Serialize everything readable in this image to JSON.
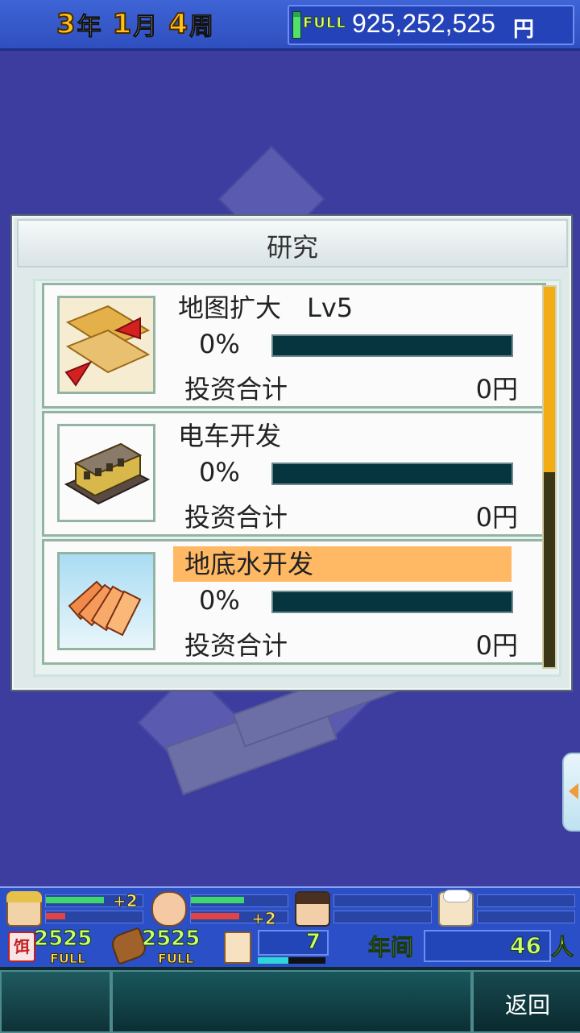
{
  "header": {
    "year_num": "3",
    "year_unit": "年",
    "month_num": "1",
    "month_unit": "月",
    "week_num": "4",
    "week_unit": "周",
    "full_tag": "FULL",
    "money": "925,252,525",
    "money_unit": "円"
  },
  "dialog": {
    "title": "研究",
    "items": [
      {
        "name": "地图扩大　Lv5",
        "percent": "0%",
        "progress": 0,
        "invest_label": "投资合计",
        "invest_value": "0円",
        "icon": "map-expand-icon",
        "selected": false
      },
      {
        "name": "电车开发",
        "percent": "0%",
        "progress": 0,
        "invest_label": "投资合计",
        "invest_value": "0円",
        "icon": "train-icon",
        "selected": false
      },
      {
        "name": "地底水开发",
        "percent": "0%",
        "progress": 0,
        "invest_label": "投资合计",
        "invest_value": "0円",
        "icon": "cards-icon",
        "selected": true
      }
    ]
  },
  "status": {
    "staff": [
      {
        "icon": "staff-straw-hat-icon",
        "plus": "+2"
      },
      {
        "icon": "staff-bald-icon",
        "plus": "+2"
      },
      {
        "icon": "staff-boy-icon",
        "plus": ""
      },
      {
        "icon": "staff-chef-icon",
        "plus": ""
      }
    ],
    "food_icon": "food-icon",
    "food_value": "2525",
    "food_full": "FULL",
    "wood_icon": "wood-icon",
    "wood_value": "2525",
    "wood_full": "FULL",
    "card_icon": "card-icon",
    "card_value": "7",
    "yearly_label": "年间",
    "yearly_value": "46",
    "yearly_unit": "人"
  },
  "bottom": {
    "back_label": "返回"
  },
  "colors": {
    "accent_orange": "#ffb964",
    "scroll_thumb": "#f3ad14",
    "header_blue": "#2f4fbf"
  }
}
